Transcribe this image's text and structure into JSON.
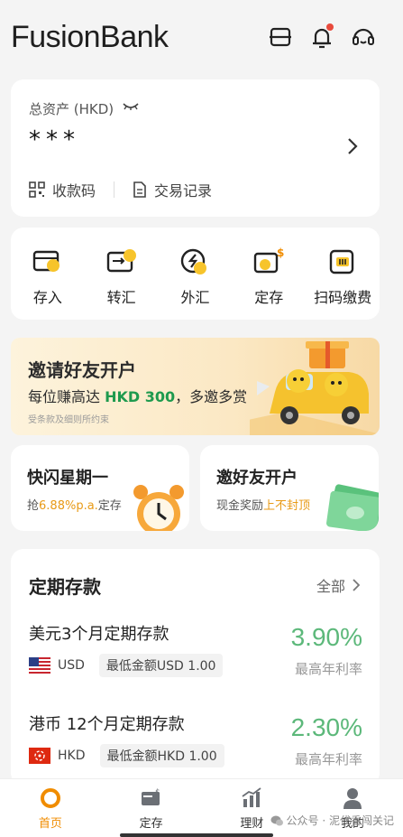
{
  "header": {
    "logo": "FusionBank",
    "icons": [
      "scan-icon",
      "bell-icon",
      "headset-icon"
    ]
  },
  "assets": {
    "label": "总资产 (HKD)",
    "value": "***",
    "links": [
      {
        "label": "收款码",
        "icon": "qr-code-icon"
      },
      {
        "label": "交易记录",
        "icon": "document-icon"
      }
    ]
  },
  "quick_actions": [
    {
      "label": "存入",
      "icon": "deposit-icon"
    },
    {
      "label": "转汇",
      "icon": "transfer-icon"
    },
    {
      "label": "外汇",
      "icon": "fx-icon"
    },
    {
      "label": "定存",
      "icon": "time-deposit-icon"
    },
    {
      "label": "扫码缴费",
      "icon": "scan-pay-icon"
    }
  ],
  "banner": {
    "title": "邀请好友开户",
    "sub_prefix": "每位赚高达 ",
    "sub_highlight": "HKD 300",
    "sub_suffix": "，多邀多赏",
    "note": "受条款及细则所约束"
  },
  "promo_left": {
    "title": "快闪星期一",
    "sub_prefix": "抢",
    "sub_highlight": "6.88%p.a.",
    "sub_suffix": "定存"
  },
  "promo_right": {
    "title": "邀好友开户",
    "sub_prefix": "现金奖励",
    "sub_highlight": "上不封顶"
  },
  "deposits": {
    "title": "定期存款",
    "all_label": "全部",
    "products": [
      {
        "name": "美元3个月定期存款",
        "currency": "USD",
        "min": "最低金额USD 1.00",
        "rate": "3.90%",
        "rate_label": "最高年利率",
        "flag": "us-flag"
      },
      {
        "name": "港币 12个月定期存款",
        "currency": "HKD",
        "min": "最低金额HKD 1.00",
        "rate": "2.30%",
        "rate_label": "最高年利率",
        "flag": "hk-flag"
      }
    ]
  },
  "tabs": [
    {
      "label": "首页",
      "active": true
    },
    {
      "label": "定存",
      "active": false
    },
    {
      "label": "理财",
      "active": false
    },
    {
      "label": "我的",
      "active": false
    }
  ],
  "watermark": "公众号 · 泥代香闯关记",
  "colors": {
    "accent": "#f08c00",
    "rate_green": "#5cb87a",
    "highlight_green": "#1e9a4e",
    "notice_red": "#e84a3c"
  }
}
